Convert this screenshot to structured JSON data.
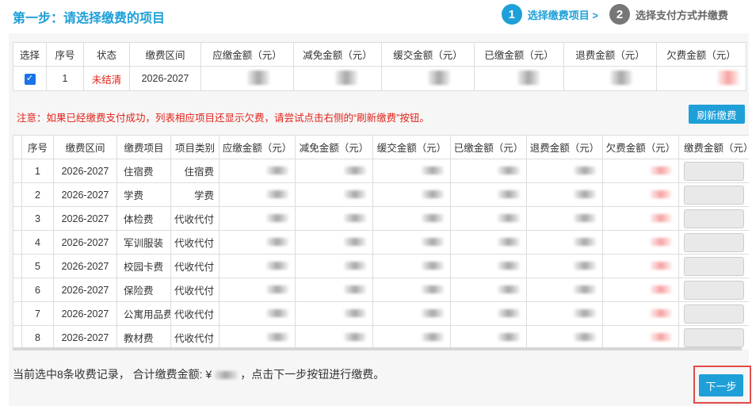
{
  "header": {
    "title": "第一步：请选择缴费的项目",
    "steps": [
      {
        "number": "1",
        "label": "选择缴费项目 >"
      },
      {
        "number": "2",
        "label": "选择支付方式并缴费"
      }
    ]
  },
  "top_table": {
    "headers": [
      "选择",
      "序号",
      "状态",
      "缴费区间",
      "应缴金额（元）",
      "减免金额（元）",
      "缓交金额（元）",
      "已缴金额（元）",
      "退费金额（元）",
      "欠费金额（元）"
    ],
    "row": {
      "checked": true,
      "index": "1",
      "status": "未结清",
      "period": "2026-2027"
    }
  },
  "notice": {
    "text": "注意：如果已经缴费支付成功，列表相应项目还显示欠费，请尝试点击右侧的“刷新缴费”按钮。",
    "refresh_label": "刷新缴费"
  },
  "items_table": {
    "headers": [
      "",
      "序号",
      "缴费区间",
      "缴费项目",
      "项目类别",
      "应缴金额（元）",
      "减免金额（元）",
      "缓交金额（元）",
      "已缴金额（元）",
      "退费金额（元）",
      "欠费金额（元）",
      "缴费金额（元）"
    ],
    "rows": [
      {
        "index": "1",
        "period": "2026-2027",
        "item": "住宿费",
        "category": "住宿费"
      },
      {
        "index": "2",
        "period": "2026-2027",
        "item": "学费",
        "category": "学费"
      },
      {
        "index": "3",
        "period": "2026-2027",
        "item": "体检费",
        "category": "代收代付"
      },
      {
        "index": "4",
        "period": "2026-2027",
        "item": "军训服装",
        "category": "代收代付"
      },
      {
        "index": "5",
        "period": "2026-2027",
        "item": "校园卡费",
        "category": "代收代付"
      },
      {
        "index": "6",
        "period": "2026-2027",
        "item": "保险费",
        "category": "代收代付"
      },
      {
        "index": "7",
        "period": "2026-2027",
        "item": "公寓用品费",
        "category": "代收代付"
      },
      {
        "index": "8",
        "period": "2026-2027",
        "item": "教材费",
        "category": "代收代付"
      }
    ]
  },
  "summary": {
    "prefix": "当前选中8条收费记录， 合计缴费金额: ¥",
    "suffix": "，点击下一步按钮进行缴费。"
  },
  "next_label": "下一步",
  "colors": {
    "accent": "#1e9fd8",
    "danger": "#e2231a",
    "highlight": "#e34a4a"
  }
}
